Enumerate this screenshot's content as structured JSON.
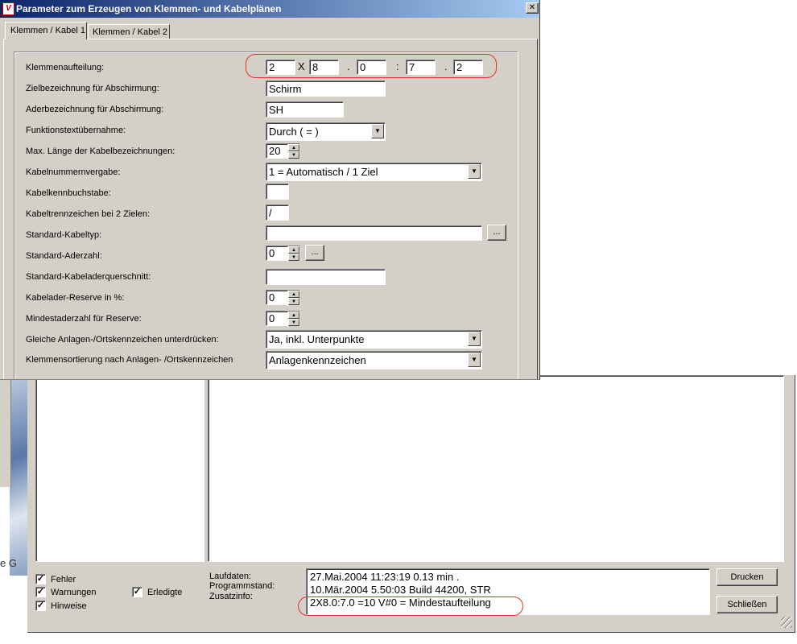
{
  "dialog": {
    "title": "Parameter zum Erzeugen von Klemmen- und Kabelplänen",
    "close_glyph": "✕",
    "tabs": [
      {
        "label": "Klemmen / Kabel 1"
      },
      {
        "label": "Klemmen / Kabel 2"
      }
    ],
    "rows": [
      {
        "label": "Klemmenaufteilung:"
      },
      {
        "label": "Zielbezeichnung für Abschirmung:",
        "value": "Schirm"
      },
      {
        "label": "Aderbezeichnung für Abschirmung:",
        "value": "SH"
      },
      {
        "label": "Funktionstextübernahme:",
        "value": "Durch ( = )"
      },
      {
        "label": "Max. Länge der Kabelbezeichnungen:",
        "value": "20"
      },
      {
        "label": "Kabelnummernvergabe:",
        "value": "1 = Automatisch / 1 Ziel"
      },
      {
        "label": "Kabelkennbuchstabe:",
        "value": ""
      },
      {
        "label": "Kabeltrennzeichen bei 2 Zielen:",
        "value": "/"
      },
      {
        "label": "Standard-Kabeltyp:",
        "value": "",
        "button": "..."
      },
      {
        "label": "Standard-Aderzahl:",
        "value": "0",
        "button": "..."
      },
      {
        "label": "Standard-Kabeladerquerschnitt:",
        "value": ""
      },
      {
        "label": "Kabelader-Reserve in %:",
        "value": "0"
      },
      {
        "label": "Mindestaderzahl für Reserve:",
        "value": "0"
      },
      {
        "label": "Gleiche Anlagen-/Ortskennzeichen unterdrücken:",
        "value": "Ja, inkl. Unterpunkte"
      },
      {
        "label": "Klemmensortierung nach Anlagen- /Ortskennzeichen",
        "value": "Anlagenkennzeichen"
      }
    ],
    "klemmen": {
      "fields": [
        "2",
        "8",
        "0",
        "7",
        "2"
      ],
      "seps": [
        "X",
        ".",
        ":",
        "."
      ]
    },
    "highlight_color": "#e03030"
  },
  "background": {
    "partial_text": "e G"
  },
  "log": {
    "checkboxes": [
      {
        "label": "Fehler",
        "checked": "✓"
      },
      {
        "label": "Warnungen",
        "checked": "✓"
      },
      {
        "label": "Hinweise",
        "checked": "✓"
      },
      {
        "label": "Erledigte",
        "checked": "✓"
      }
    ],
    "info_labels": [
      "Laufdaten:",
      "Programmstand:",
      "Zusatzinfo:"
    ],
    "info_lines": [
      "27.Mai.2004 11:23:19  0.13 min .",
      "10.Mär.2004 5.50:03 Build 44200, STR",
      "2X8.0:7.0  =10 V#0 = Mindestaufteilung"
    ],
    "buttons": {
      "print": "Drucken",
      "close": "Schließen"
    }
  }
}
